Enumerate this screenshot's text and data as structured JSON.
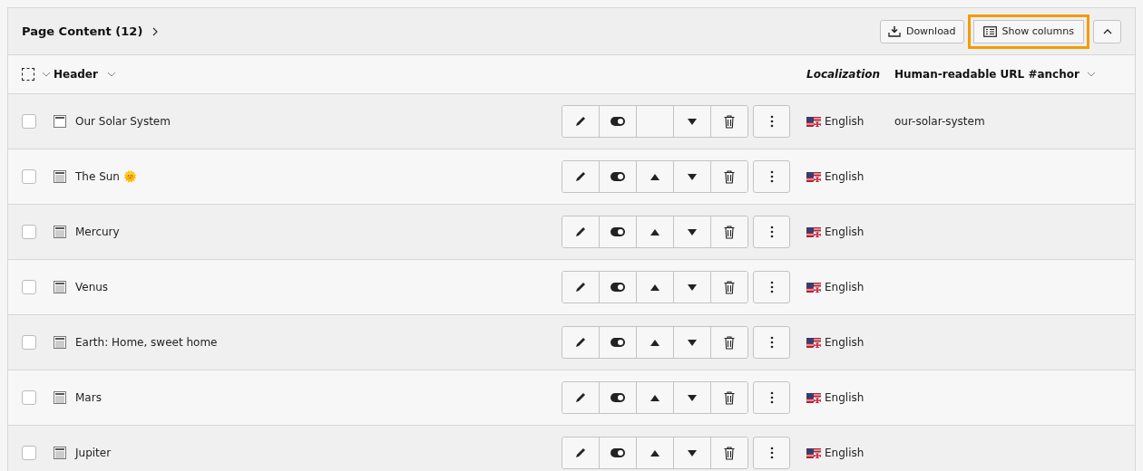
{
  "panel": {
    "title": "Page Content (12)",
    "actions": [
      {
        "label": "Download",
        "kind": "download",
        "highlighted": false
      },
      {
        "label": "Show columns",
        "kind": "columns",
        "highlighted": true
      }
    ]
  },
  "columns": {
    "select_all_checked": false,
    "header": "Header",
    "localization": "Localization",
    "url": "Human-readable URL #anchor"
  },
  "rows": [
    {
      "title": "Our Solar System",
      "kind": "header",
      "checked": false,
      "can_move_up": false,
      "language": "English",
      "url": "our-solar-system"
    },
    {
      "title": "The Sun 🌞",
      "kind": "text",
      "checked": false,
      "can_move_up": true,
      "language": "English"
    },
    {
      "title": "Mercury",
      "kind": "text",
      "checked": false,
      "can_move_up": true,
      "language": "English"
    },
    {
      "title": "Venus",
      "kind": "text",
      "checked": false,
      "can_move_up": true,
      "language": "English"
    },
    {
      "title": "Earth: Home, sweet home",
      "kind": "text",
      "checked": false,
      "can_move_up": true,
      "language": "English"
    },
    {
      "title": "Mars",
      "kind": "text",
      "checked": false,
      "can_move_up": true,
      "language": "English"
    },
    {
      "title": "Jupiter",
      "kind": "text",
      "checked": false,
      "can_move_up": true,
      "language": "English"
    }
  ]
}
